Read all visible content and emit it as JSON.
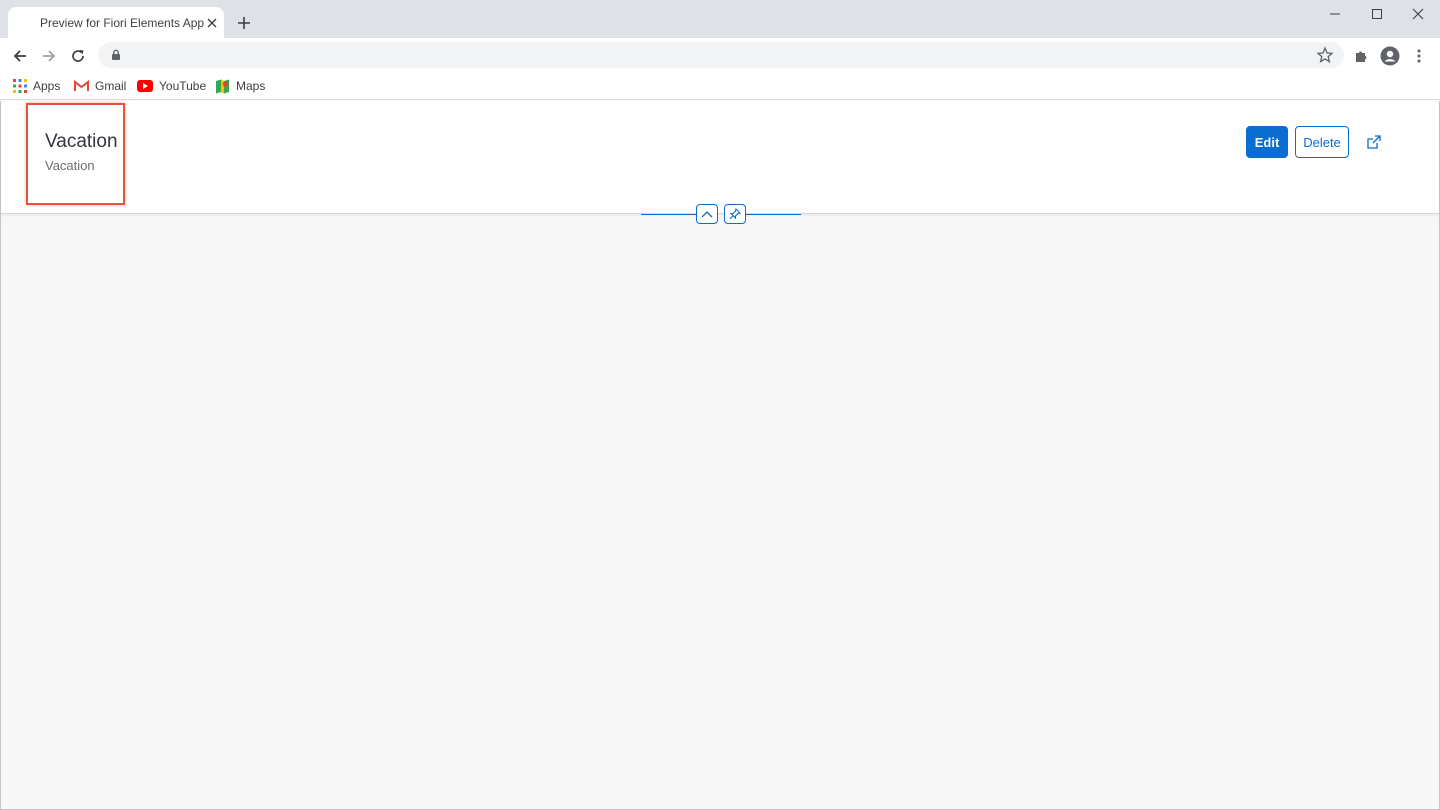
{
  "browser": {
    "tab_title": "Preview for Fiori Elements App",
    "bookmarks": [
      {
        "label": "Apps"
      },
      {
        "label": "Gmail"
      },
      {
        "label": "YouTube"
      },
      {
        "label": "Maps"
      }
    ]
  },
  "object_page": {
    "title": "Vacation",
    "subtitle": "Vacation",
    "actions": {
      "edit_label": "Edit",
      "delete_label": "Delete"
    }
  },
  "colors": {
    "accent": "#0a6ed1",
    "highlight": "#e8533c"
  },
  "icons": [
    "back-icon",
    "forward-icon",
    "reload-icon",
    "lock-icon",
    "star-icon",
    "extensions-icon",
    "profile-icon",
    "menu-icon",
    "share-icon",
    "collapse-header-icon",
    "pin-header-icon"
  ]
}
